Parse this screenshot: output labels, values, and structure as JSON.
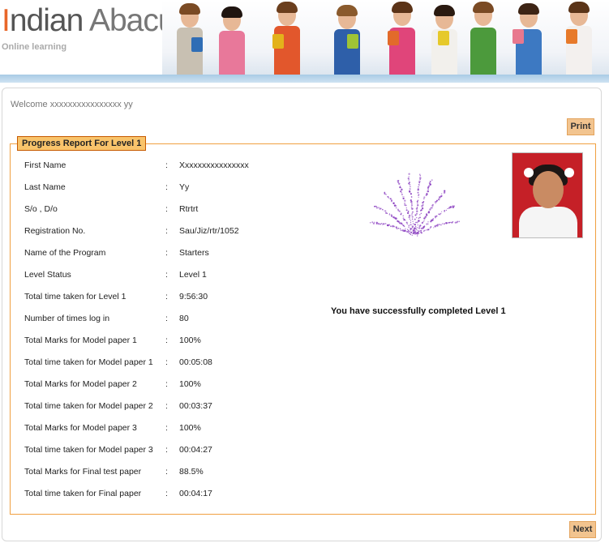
{
  "header": {
    "logo_initial": "I",
    "logo_word1": "ndian",
    "logo_word2": "Abacus",
    "tagline": "Online learning"
  },
  "welcome_text": "Welcome xxxxxxxxxxxxxxxx yy",
  "buttons": {
    "print": "Print",
    "next": "Next"
  },
  "report": {
    "title": "Progress Report For Level 1",
    "rows": [
      {
        "label": "First Name",
        "value": "Xxxxxxxxxxxxxxxx"
      },
      {
        "label": "Last Name",
        "value": "Yy"
      },
      {
        "label": "S/o , D/o",
        "value": "Rtrtrt"
      },
      {
        "label": "Registration No.",
        "value": "Sau/Jiz/rtr/1052"
      },
      {
        "label": "Name of the Program",
        "value": "Starters"
      },
      {
        "label": "Level Status",
        "value": "Level 1"
      },
      {
        "label": "Total time taken for Level 1",
        "value": "9:56:30"
      },
      {
        "label": "Number of times log in",
        "value": "80"
      },
      {
        "label": "Total Marks for Model paper 1",
        "value": "100%"
      },
      {
        "label": "Total time taken for Model paper 1",
        "value": "00:05:08"
      },
      {
        "label": "Total Marks for Model paper 2",
        "value": "100%"
      },
      {
        "label": "Total time taken for Model paper 2",
        "value": "00:03:37"
      },
      {
        "label": "Total Marks for Model paper 3",
        "value": "100%"
      },
      {
        "label": "Total time taken for Model paper 3",
        "value": "00:04:27"
      },
      {
        "label": "Total Marks for Final test paper",
        "value": "88.5%"
      },
      {
        "label": "Total time taken for Final paper",
        "value": "00:04:17"
      }
    ],
    "colon": ":",
    "success_message": "You have successfully completed Level 1"
  },
  "colors": {
    "accent_orange": "#f2c48f",
    "legend_bg": "#f9c46b",
    "border_orange": "#f0a040",
    "header_blue": "#a8cbe5",
    "firework_purple": "#8a3fc0"
  },
  "icons": {
    "firework": "firework-graphic",
    "student_photo": "student-photo"
  }
}
